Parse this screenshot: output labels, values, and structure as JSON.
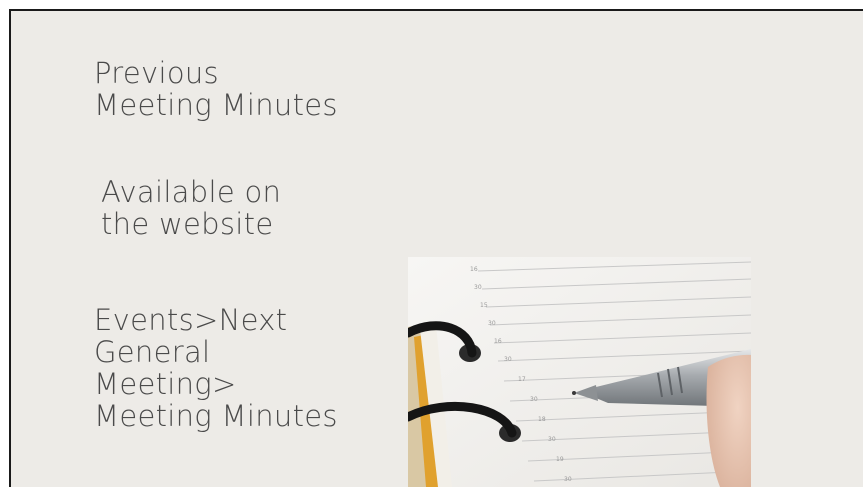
{
  "slide": {
    "heading": [
      "Previous",
      "Meeting Minutes"
    ],
    "availability": [
      "Available on",
      "the website"
    ],
    "path": [
      "Events>Next",
      "General",
      "Meeting>",
      "Meeting Minutes"
    ]
  },
  "image": {
    "subject": "planner-with-pen",
    "colors": {
      "page": "#f3f2ef",
      "ring": "#1c1c1c",
      "pen": "#b9bcbf",
      "hand": "#e7c8b6",
      "edge": "#d99b2a"
    }
  }
}
